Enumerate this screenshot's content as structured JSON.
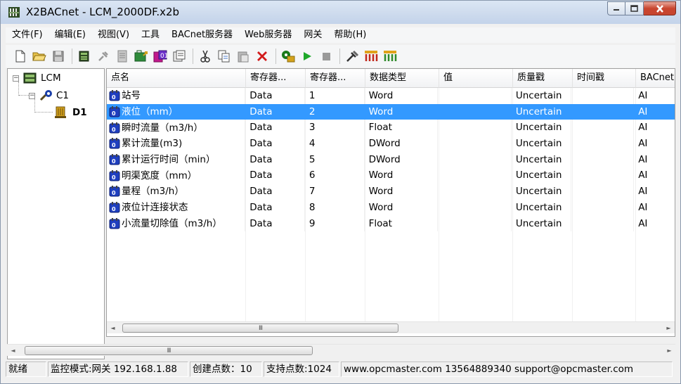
{
  "window": {
    "title": "X2BACnet - LCM_2000DF.x2b",
    "buttons": {
      "minimize": "minimize",
      "maximize": "maximize",
      "close": "close"
    }
  },
  "menu": [
    "文件(F)",
    "编辑(E)",
    "视图(V)",
    "工具",
    "BACnet服务器",
    "Web服务器",
    "网关",
    "帮助(H)"
  ],
  "toolbar": {
    "buttons": [
      "new-icon",
      "open-icon",
      "save-icon",
      "add-device-icon",
      "link-icon",
      "properties-icon",
      "add-group-icon",
      "add-tag-icon",
      "copy-props-icon",
      "cut-icon",
      "copy-icon",
      "paste-icon",
      "delete-icon",
      "run-config-icon",
      "start-icon",
      "stop-icon",
      "tools-icon",
      "bacnet-icon",
      "web-icon"
    ]
  },
  "tree": {
    "root": {
      "label": "LCM",
      "expander": "−"
    },
    "channel": {
      "label": "C1",
      "expander": "−"
    },
    "device": {
      "label": "D1"
    }
  },
  "table": {
    "columns": [
      "点名",
      "寄存器...",
      "寄存器...",
      "数据类型",
      "值",
      "质量戳",
      "时间戳",
      "BACnet"
    ],
    "rows": [
      {
        "name": "站号",
        "reg_type": "Data",
        "reg_addr": "1",
        "data_type": "Word",
        "value": "",
        "quality": "Uncertain",
        "timestamp": "",
        "bacnet": "AI"
      },
      {
        "name": "液位（mm）",
        "reg_type": "Data",
        "reg_addr": "2",
        "data_type": "Word",
        "value": "",
        "quality": "Uncertain",
        "timestamp": "",
        "bacnet": "AI"
      },
      {
        "name": "瞬时流量（m3/h）",
        "reg_type": "Data",
        "reg_addr": "3",
        "data_type": "Float",
        "value": "",
        "quality": "Uncertain",
        "timestamp": "",
        "bacnet": "AI"
      },
      {
        "name": "累计流量(m3)",
        "reg_type": "Data",
        "reg_addr": "4",
        "data_type": "DWord",
        "value": "",
        "quality": "Uncertain",
        "timestamp": "",
        "bacnet": "AI"
      },
      {
        "name": "累计运行时间（min）",
        "reg_type": "Data",
        "reg_addr": "5",
        "data_type": "DWord",
        "value": "",
        "quality": "Uncertain",
        "timestamp": "",
        "bacnet": "AI"
      },
      {
        "name": "明渠宽度（mm）",
        "reg_type": "Data",
        "reg_addr": "6",
        "data_type": "Word",
        "value": "",
        "quality": "Uncertain",
        "timestamp": "",
        "bacnet": "AI"
      },
      {
        "name": "量程（m3/h）",
        "reg_type": "Data",
        "reg_addr": "7",
        "data_type": "Word",
        "value": "",
        "quality": "Uncertain",
        "timestamp": "",
        "bacnet": "AI"
      },
      {
        "name": "液位计连接状态",
        "reg_type": "Data",
        "reg_addr": "8",
        "data_type": "Word",
        "value": "",
        "quality": "Uncertain",
        "timestamp": "",
        "bacnet": "AI"
      },
      {
        "name": "小流量切除值（m3/h）",
        "reg_type": "Data",
        "reg_addr": "9",
        "data_type": "Float",
        "value": "",
        "quality": "Uncertain",
        "timestamp": "",
        "bacnet": "AI"
      }
    ],
    "selected_row": 1
  },
  "scroll": {
    "thumb_grip": "III"
  },
  "status": {
    "ready": "就绪",
    "mode": "监控模式:网关 192.168.1.88",
    "created_points": "创建点数：10",
    "supported_points": "支持点数:1024",
    "contact": "www.opcmaster.com 13564889340 support@opcmaster.com"
  },
  "colors": {
    "selection": "#3399ff",
    "tag_icon": "#1f3fbf",
    "close_button": "#c7452f"
  }
}
